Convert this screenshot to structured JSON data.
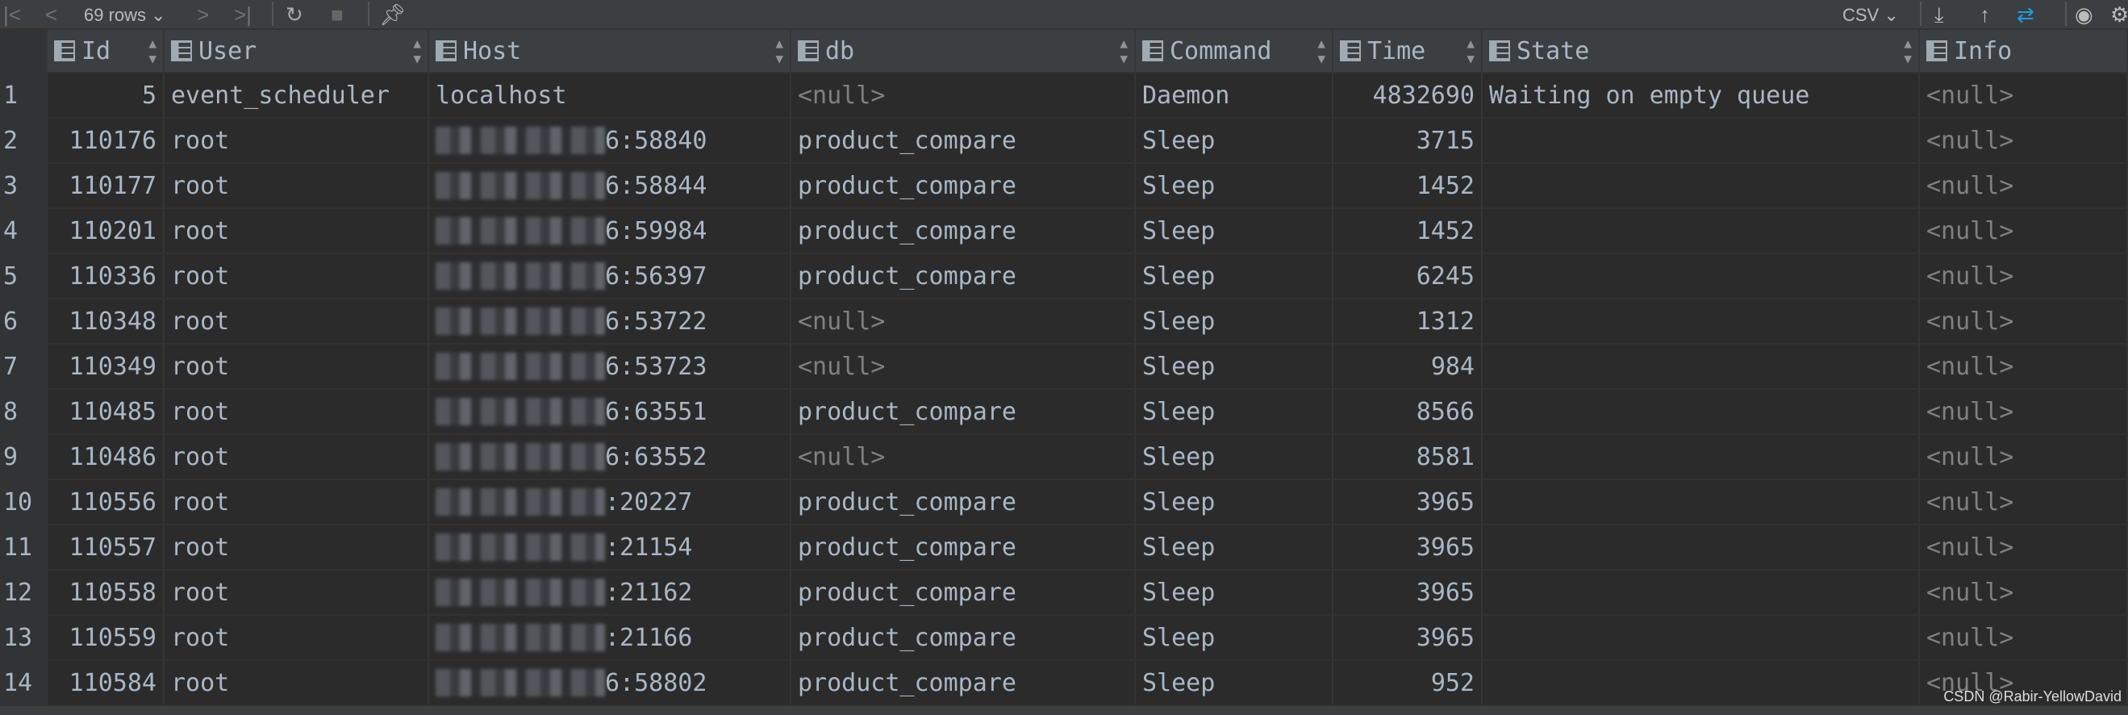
{
  "toolbar": {
    "rows_label": "69 rows",
    "export_format": "CSV",
    "accent": "#1e9ede"
  },
  "columns": [
    "Id",
    "User",
    "Host",
    "db",
    "Command",
    "Time",
    "State",
    "Info"
  ],
  "rows": [
    [
      "1",
      "5",
      "event_scheduler",
      "localhost",
      "<null>",
      "Daemon",
      "4832690",
      "Waiting on empty queue",
      "<null>"
    ],
    [
      "2",
      "110176",
      "root",
      "6:58840",
      "product_compare",
      "Sleep",
      "3715",
      "",
      "<null>"
    ],
    [
      "3",
      "110177",
      "root",
      "6:58844",
      "product_compare",
      "Sleep",
      "1452",
      "",
      "<null>"
    ],
    [
      "4",
      "110201",
      "root",
      "6:59984",
      "product_compare",
      "Sleep",
      "1452",
      "",
      "<null>"
    ],
    [
      "5",
      "110336",
      "root",
      "6:56397",
      "product_compare",
      "Sleep",
      "6245",
      "",
      "<null>"
    ],
    [
      "6",
      "110348",
      "root",
      "6:53722",
      "<null>",
      "Sleep",
      "1312",
      "",
      "<null>"
    ],
    [
      "7",
      "110349",
      "root",
      "6:53723",
      "<null>",
      "Sleep",
      "984",
      "",
      "<null>"
    ],
    [
      "8",
      "110485",
      "root",
      "6:63551",
      "product_compare",
      "Sleep",
      "8566",
      "",
      "<null>"
    ],
    [
      "9",
      "110486",
      "root",
      "6:63552",
      "<null>",
      "Sleep",
      "8581",
      "",
      "<null>"
    ],
    [
      "10",
      "110556",
      "root",
      ":20227",
      "product_compare",
      "Sleep",
      "3965",
      "",
      "<null>"
    ],
    [
      "11",
      "110557",
      "root",
      ":21154",
      "product_compare",
      "Sleep",
      "3965",
      "",
      "<null>"
    ],
    [
      "12",
      "110558",
      "root",
      ":21162",
      "product_compare",
      "Sleep",
      "3965",
      "",
      "<null>"
    ],
    [
      "13",
      "110559",
      "root",
      ":21166",
      "product_compare",
      "Sleep",
      "3965",
      "",
      "<null>"
    ],
    [
      "14",
      "110584",
      "root",
      "6:58802",
      "product_compare",
      "Sleep",
      "952",
      "",
      "<null>"
    ]
  ],
  "watermark": "CSDN @Rabir-YellowDavid"
}
